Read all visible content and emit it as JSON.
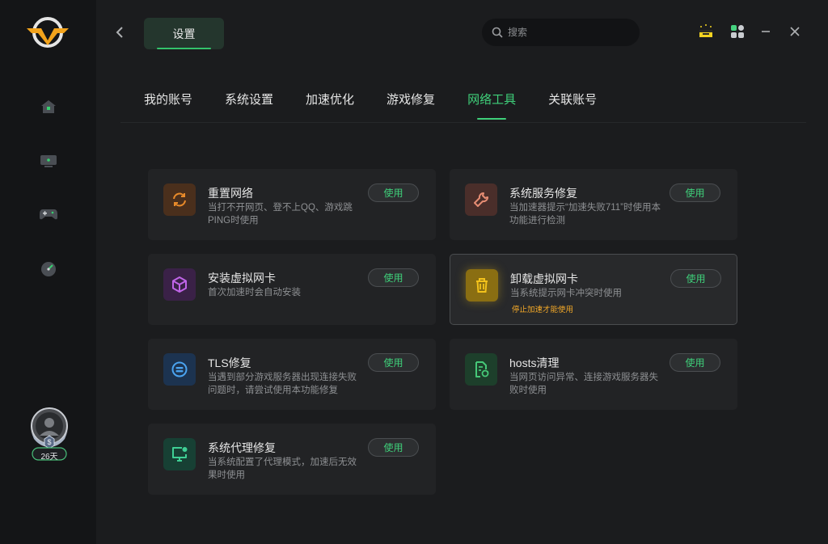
{
  "header": {
    "title": "设置",
    "search_placeholder": "搜索"
  },
  "sidebar": {
    "items": [
      {
        "name": "home-icon"
      },
      {
        "name": "monitor-icon"
      },
      {
        "name": "gamepad-icon"
      },
      {
        "name": "speedometer-icon"
      }
    ],
    "user": {
      "days_label": "26天",
      "vip_badge": "$"
    }
  },
  "tabs": [
    {
      "label": "我的账号",
      "active": false
    },
    {
      "label": "系统设置",
      "active": false
    },
    {
      "label": "加速优化",
      "active": false
    },
    {
      "label": "游戏修复",
      "active": false
    },
    {
      "label": "网络工具",
      "active": true
    },
    {
      "label": "关联账号",
      "active": false
    }
  ],
  "tools": [
    {
      "title": "重置网络",
      "desc": "当打不开网页、登不上QQ、游戏跳PING时使用",
      "button": "使用",
      "icon": "refresh-icon",
      "icon_color": "#e88a2a",
      "icon_bg": "#4a2f1c"
    },
    {
      "title": "系统服务修复",
      "desc": "当加速器提示“加速失败711”时使用本功能进行检测",
      "button": "使用",
      "icon": "wrench-icon",
      "icon_color": "#e58c73",
      "icon_bg": "#4a2e2a"
    },
    {
      "title": "安装虚拟网卡",
      "desc": "首次加速时会自动安装",
      "button": "使用",
      "icon": "cube-icon",
      "icon_color": "#c065e8",
      "icon_bg": "#3a2147"
    },
    {
      "title": "卸载虚拟网卡",
      "desc": "当系统提示网卡冲突时使用",
      "warning": "停止加速才能使用",
      "button": "使用",
      "icon": "trash-icon",
      "icon_color": "#f3c21b",
      "icon_bg": "#8a6e12"
    },
    {
      "title": "TLS修复",
      "desc": "当遇到部分游戏服务器出现连接失败问题时，请尝试使用本功能修复",
      "button": "使用",
      "icon": "tls-icon",
      "icon_color": "#4aa3f0",
      "icon_bg": "#1c3350"
    },
    {
      "title": "hosts清理",
      "desc": "当网页访问异常、连接游戏服务器失败时使用",
      "button": "使用",
      "icon": "document-refresh-icon",
      "icon_color": "#46c878",
      "icon_bg": "#1d3f2b"
    },
    {
      "title": "系统代理修复",
      "desc": "当系统配置了代理模式，加速后无效果时使用",
      "button": "使用",
      "icon": "monitor-settings-icon",
      "icon_color": "#3fcf95",
      "icon_bg": "#174034"
    }
  ],
  "colors": {
    "accent": "#3fd07a",
    "warning": "#f2a828",
    "background": "#1b1c1e",
    "sidebar": "#141517",
    "card": "#222325"
  }
}
